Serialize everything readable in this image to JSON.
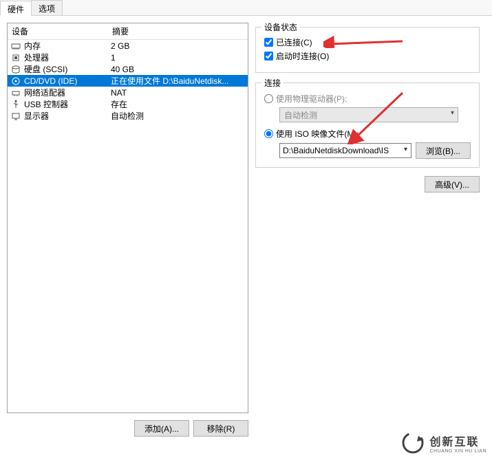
{
  "tabs": {
    "hardware": "硬件",
    "options": "选项"
  },
  "list": {
    "header_device": "设备",
    "header_summary": "摘要",
    "rows": [
      {
        "icon": "memory-icon",
        "device": "内存",
        "summary": "2 GB"
      },
      {
        "icon": "cpu-icon",
        "device": "处理器",
        "summary": "1"
      },
      {
        "icon": "disk-icon",
        "device": "硬盘 (SCSI)",
        "summary": "40 GB"
      },
      {
        "icon": "cd-icon",
        "device": "CD/DVD (IDE)",
        "summary": "正在使用文件 D:\\BaiduNetdisk..."
      },
      {
        "icon": "network-icon",
        "device": "网络适配器",
        "summary": "NAT"
      },
      {
        "icon": "usb-icon",
        "device": "USB 控制器",
        "summary": "存在"
      },
      {
        "icon": "display-icon",
        "device": "显示器",
        "summary": "自动检测"
      }
    ]
  },
  "buttons": {
    "add": "添加(A)...",
    "remove": "移除(R)",
    "browse": "浏览(B)...",
    "advanced": "高级(V)..."
  },
  "device_status": {
    "title": "设备状态",
    "connected": "已连接(C)",
    "connect_at_power_on": "启动时连接(O)"
  },
  "connection": {
    "title": "连接",
    "use_physical": "使用物理驱动器(P):",
    "autodetect": "自动检测",
    "use_iso": "使用 ISO 映像文件(M):",
    "iso_path": "D:\\BaiduNetdiskDownload\\IS"
  },
  "watermark": {
    "text": "创新互联",
    "sub": "CHUANG XIN HU LIAN"
  }
}
